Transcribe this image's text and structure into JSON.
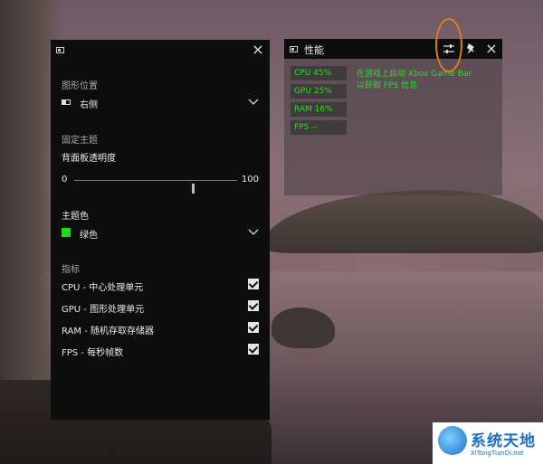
{
  "settings_panel": {
    "title": "",
    "pin_position_section": "图形位置",
    "pin_position_value": "右侧",
    "lock_theme_section": "固定主题",
    "opacity_label": "背面板透明度",
    "opacity_min": "0",
    "opacity_max": "100",
    "opacity_level": 0.72,
    "accent_label": "主题色",
    "accent_value": "绿色",
    "accent_color": "#14e014",
    "metrics_section": "指标",
    "metrics": [
      {
        "label": "CPU - 中心处理单元",
        "checked": true
      },
      {
        "label": "GPU - 图形处理单元",
        "checked": true
      },
      {
        "label": "RAM - 随机存取存储器",
        "checked": true
      },
      {
        "label": "FPS - 每秒帧数",
        "checked": true
      }
    ]
  },
  "performance_widget": {
    "title": "性能",
    "metrics": [
      {
        "label": "CPU  45%"
      },
      {
        "label": "GPU  25%"
      },
      {
        "label": "RAM  16%"
      },
      {
        "label": "FPS --"
      }
    ],
    "hint_line1": "在游戏上启动 Xbox Game Bar",
    "hint_line2": "以获取 FPS 信息",
    "text_color": "#22e022"
  },
  "annotation": {
    "ring_color": "#e07a1c"
  },
  "watermark": {
    "main": "系统天地",
    "sub": "XiTongTianDi.net"
  }
}
